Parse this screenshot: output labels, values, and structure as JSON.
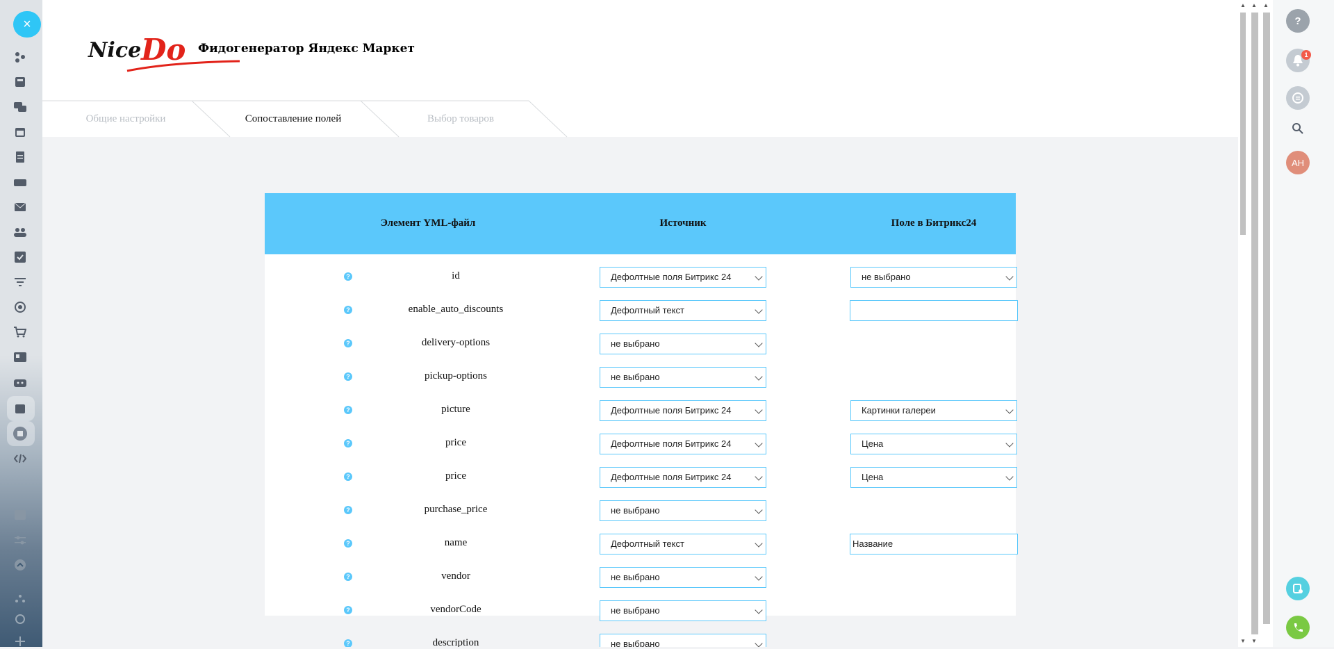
{
  "app": {
    "title": "Фидогенератор Яндекс Маркет",
    "logo_text_left": "Nice",
    "logo_text_right": "Do"
  },
  "tabs": [
    {
      "label": "Общие настройки",
      "active": false
    },
    {
      "label": "Сопоставление полей",
      "active": true
    },
    {
      "label": "Выбор товаров",
      "active": false
    }
  ],
  "table": {
    "headers": [
      "Элемент YML-файл",
      "Источник",
      "Поле в Битрикс24"
    ],
    "help_glyph": "?",
    "rows": [
      {
        "element": "id",
        "source": "Дефолтные поля Битрикс 24",
        "field": "не выбрано",
        "field_type": "select"
      },
      {
        "element": "enable_auto_discounts",
        "source": "Дефолтный текст",
        "field": "",
        "field_type": "text"
      },
      {
        "element": "delivery-options",
        "source": "не выбрано",
        "field": null,
        "field_type": "none"
      },
      {
        "element": "pickup-options",
        "source": "не выбрано",
        "field": null,
        "field_type": "none"
      },
      {
        "element": "picture",
        "source": "Дефолтные поля Битрикс 24",
        "field": "Картинки галереи",
        "field_type": "select"
      },
      {
        "element": "price",
        "source": "Дефолтные поля Битрикс 24",
        "field": "Цена",
        "field_type": "select"
      },
      {
        "element": "price",
        "source": "Дефолтные поля Битрикс 24",
        "field": "Цена",
        "field_type": "select"
      },
      {
        "element": "purchase_price",
        "source": "не выбрано",
        "field": null,
        "field_type": "none"
      },
      {
        "element": "name",
        "source": "Дефолтный текст",
        "field": "Название",
        "field_type": "text"
      },
      {
        "element": "vendor",
        "source": "не выбрано",
        "field": null,
        "field_type": "none"
      },
      {
        "element": "vendorCode",
        "source": "не выбрано",
        "field": null,
        "field_type": "none"
      },
      {
        "element": "description",
        "source": "не выбрано",
        "field": null,
        "field_type": "none"
      }
    ]
  },
  "right_rail": {
    "notifications_badge": "1",
    "avatar_initials": "АН"
  },
  "close_glyph": "×",
  "colors": {
    "accent": "#5bc8fb",
    "close": "#2fc6f6",
    "avatar": "#e08e7a",
    "phone": "#7ac943",
    "badge": "#f25a4a"
  }
}
